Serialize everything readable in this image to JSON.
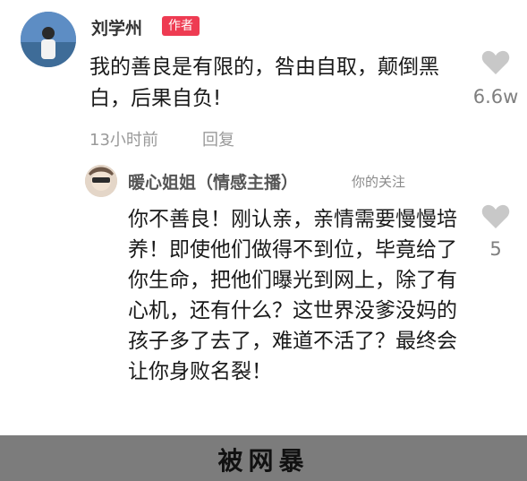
{
  "comment1": {
    "author": "刘学州",
    "badge": "作者",
    "text": "我的善良是有限的，咎由自取，颠倒黑白，后果自负!",
    "time": "13小时前",
    "reply": "回复",
    "likes": "6.6w"
  },
  "comment2": {
    "author": "暖心姐姐（情感主播）",
    "tag": "你的关注",
    "text": "你不善良！刚认亲，亲情需要慢慢培养！即使他们做得不到位，毕竟给了你生命，把他们曝光到网上，除了有心机，还有什么？这世界没爹没妈的孩子多了去了，难道不活了？最终会让你身败名裂！",
    "likes": "5"
  },
  "caption": "被网暴",
  "colors": {
    "badge": "#ee3b52",
    "heart": "#c8c8c8",
    "bar": "#7c7c7c"
  }
}
